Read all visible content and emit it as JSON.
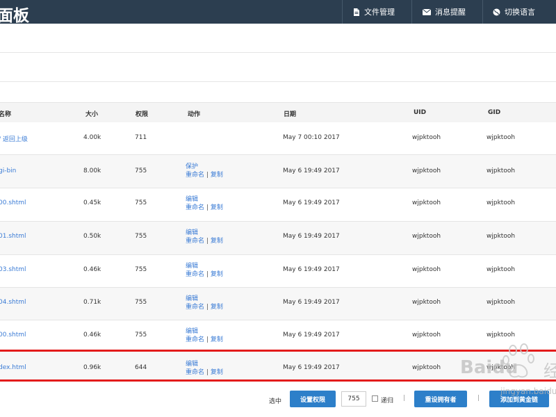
{
  "header": {
    "brand": "面板",
    "nav": [
      {
        "label": "文件管理",
        "icon": "document-icon"
      },
      {
        "label": "消息提醒",
        "icon": "envelope-icon"
      },
      {
        "label": "切换语言",
        "icon": "globe-icon"
      }
    ]
  },
  "table": {
    "columns": [
      "名称",
      "大小",
      "权限",
      "动作",
      "日期",
      "UID",
      "GID"
    ],
    "rows": [
      {
        "name": "/ 返回上级",
        "size": "4.00k",
        "perm": "711",
        "actions": [],
        "date": "May 7 00:10 2017",
        "uid": "wjpktooh",
        "gid": "wjpktooh"
      },
      {
        "name": "gi-bin",
        "size": "8.00k",
        "perm": "755",
        "actions": [
          "保护",
          "重命名",
          "复制"
        ],
        "date": "May 6 19:49 2017",
        "uid": "wjpktooh",
        "gid": "wjpktooh"
      },
      {
        "name": "00.shtml",
        "size": "0.45k",
        "perm": "755",
        "actions": [
          "编辑",
          "重命名",
          "复制"
        ],
        "date": "May 6 19:49 2017",
        "uid": "wjpktooh",
        "gid": "wjpktooh"
      },
      {
        "name": "01.shtml",
        "size": "0.50k",
        "perm": "755",
        "actions": [
          "编辑",
          "重命名",
          "复制"
        ],
        "date": "May 6 19:49 2017",
        "uid": "wjpktooh",
        "gid": "wjpktooh"
      },
      {
        "name": "03.shtml",
        "size": "0.46k",
        "perm": "755",
        "actions": [
          "编辑",
          "重命名",
          "复制"
        ],
        "date": "May 6 19:49 2017",
        "uid": "wjpktooh",
        "gid": "wjpktooh"
      },
      {
        "name": "04.shtml",
        "size": "0.71k",
        "perm": "755",
        "actions": [
          "编辑",
          "重命名",
          "复制"
        ],
        "date": "May 6 19:49 2017",
        "uid": "wjpktooh",
        "gid": "wjpktooh"
      },
      {
        "name": "00.shtml",
        "size": "0.46k",
        "perm": "755",
        "actions": [
          "编辑",
          "重命名",
          "复制"
        ],
        "date": "May 6 19:49 2017",
        "uid": "wjpktooh",
        "gid": "wjpktooh"
      },
      {
        "name": "dex.html",
        "size": "0.96k",
        "perm": "644",
        "actions": [
          "编辑",
          "重命名",
          "复制"
        ],
        "date": "May 6 19:49 2017",
        "uid": "wjpktooh",
        "gid": "wjpktooh"
      }
    ]
  },
  "footer": {
    "selected_label": "选中",
    "set_perm_label": "设置权限",
    "perm_value": "755",
    "recursive_label": "递归",
    "set_owner_label": "重设拥有者",
    "add_label": "添加到黄金链",
    "divider": "|"
  },
  "watermark": {
    "brand": "Baidu",
    "suffix": "经",
    "domain": "jingyan.baidu"
  },
  "colors": {
    "topbar": "#2c3e50",
    "link": "#3a7bd5",
    "button": "#2d7fc9",
    "highlight": "#e31b1b"
  }
}
